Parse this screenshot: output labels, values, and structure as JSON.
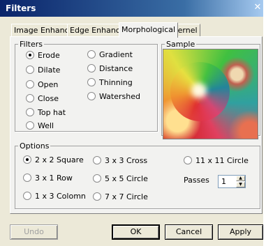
{
  "window": {
    "title": "Filters",
    "close_glyph": "✕"
  },
  "tabs": [
    {
      "label": "Image Enhance",
      "active": false
    },
    {
      "label": "Edge Enhance",
      "active": false
    },
    {
      "label": "Morphological",
      "active": true
    },
    {
      "label": "Kernel",
      "active": false
    }
  ],
  "filters_group": {
    "legend": "Filters",
    "items": [
      {
        "label": "Erode",
        "checked": true
      },
      {
        "label": "Dilate",
        "checked": false
      },
      {
        "label": "Open",
        "checked": false
      },
      {
        "label": "Close",
        "checked": false
      },
      {
        "label": "Top hat",
        "checked": false
      },
      {
        "label": "Well",
        "checked": false
      },
      {
        "label": "Gradient",
        "checked": false
      },
      {
        "label": "Distance",
        "checked": false
      },
      {
        "label": "Thinning",
        "checked": false
      },
      {
        "label": "Watershed",
        "checked": false
      }
    ]
  },
  "sample_group": {
    "legend": "Sample"
  },
  "options_group": {
    "legend": "Options",
    "items": [
      {
        "label": "2 x 2 Square",
        "checked": true
      },
      {
        "label": "3 x 1 Row",
        "checked": false
      },
      {
        "label": "1 x 3 Colomn",
        "checked": false
      },
      {
        "label": "3 x 3 Cross",
        "checked": false
      },
      {
        "label": "5 x 5 Circle",
        "checked": false
      },
      {
        "label": "7 x 7 Circle",
        "checked": false
      },
      {
        "label": "11 x 11 Circle",
        "checked": false
      }
    ],
    "passes_label": "Passes",
    "passes_value": "1"
  },
  "buttons": {
    "undo": "Undo",
    "ok": "OK",
    "cancel": "Cancel",
    "apply": "Apply"
  }
}
